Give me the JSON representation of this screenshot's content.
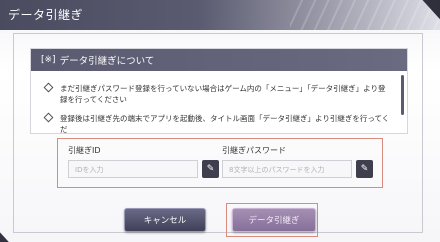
{
  "dialog": {
    "title": "データ引継ぎ"
  },
  "info": {
    "header_mark": "[※]",
    "header": "データ引継ぎについて",
    "items": [
      "まだ引継ぎパスワード登録を行っていない場合はゲーム内の「メニュー」「データ引継ぎ」より登録を行ってください",
      "登録後は引継ぎ先の端末でアプリを起動後、タイトル画面「データ引継ぎ」より引継ぎを行ってくだ"
    ]
  },
  "fields": {
    "id": {
      "label": "引継ぎID",
      "placeholder": "IDを入力"
    },
    "password": {
      "label": "引継ぎパスワード",
      "placeholder": "8文字以上のパスワードを入力"
    }
  },
  "buttons": {
    "cancel": "キャンセル",
    "transfer": "データ引継ぎ"
  },
  "icons": {
    "edit": "pencil-icon",
    "bullet": "diamond-bullet-icon"
  }
}
